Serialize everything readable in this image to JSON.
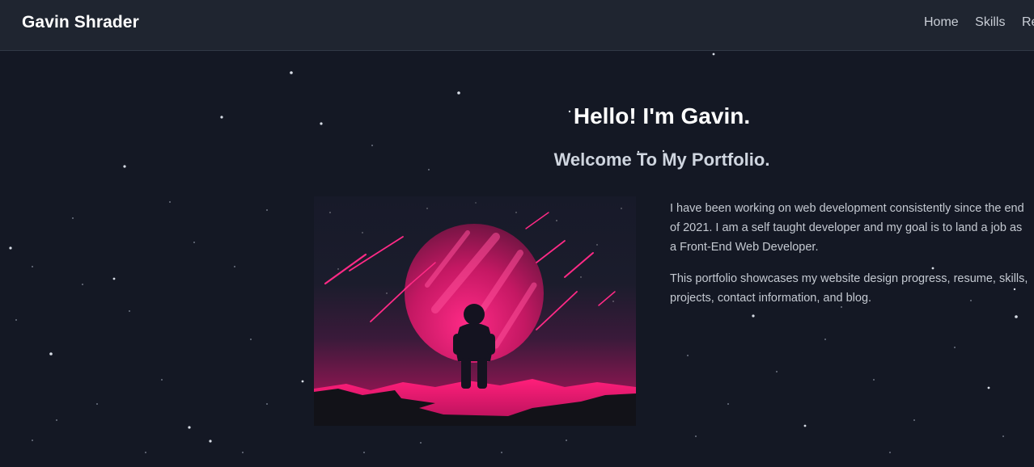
{
  "nav": {
    "brand": "Gavin Shrader",
    "links": [
      "Home",
      "Skills",
      "Res"
    ]
  },
  "hero": {
    "title": "Hello! I'm Gavin.",
    "subtitle": "Welcome To My Portfolio.",
    "paragraphs": [
      "I have been working on web development consistently since the end of 2021. I am a self taught developer and my goal is to land a job as a Front-End Web Developer.",
      "This portfolio showcases my website design progress, resume, skills, projects, contact information, and blog."
    ]
  },
  "colors": {
    "background": "#141824",
    "navbar": "#1f2530",
    "accent_pink": "#ff1f7a"
  }
}
